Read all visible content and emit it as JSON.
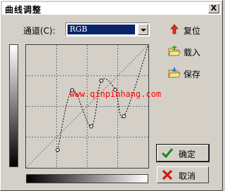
{
  "window": {
    "title": "曲线调整",
    "close_label": "X"
  },
  "channel": {
    "label": "通道(C):",
    "value": "RGB"
  },
  "side_buttons": {
    "reset": "复位",
    "load": "载入",
    "save": "保存"
  },
  "buttons": {
    "ok": "确定",
    "cancel": "取消"
  },
  "watermark": "www.qinpinhang.com",
  "chart_data": {
    "type": "line",
    "title": "",
    "xlabel": "",
    "ylabel": "",
    "xlim": [
      0,
      255
    ],
    "ylim": [
      0,
      255
    ],
    "grid": true,
    "control_points": [
      {
        "x": 66,
        "y": 37
      },
      {
        "x": 96,
        "y": 161
      },
      {
        "x": 136,
        "y": 86
      },
      {
        "x": 157,
        "y": 181
      },
      {
        "x": 186,
        "y": 162
      },
      {
        "x": 204,
        "y": 107
      },
      {
        "x": 255,
        "y": 255
      }
    ],
    "diagonal": true
  }
}
